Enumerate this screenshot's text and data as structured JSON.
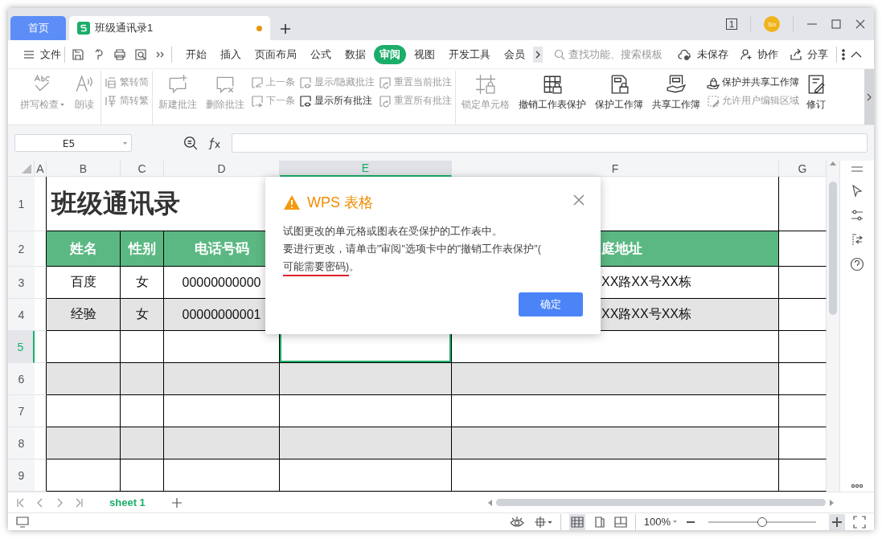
{
  "title_bar": {
    "home_tab": {
      "label": "首页",
      "selected": false
    },
    "doc_tab": {
      "label": "班级通讯录1",
      "selected": true,
      "unsaved": true
    },
    "window_count": "1",
    "avatar": "Sn"
  },
  "menu": {
    "file": "文件",
    "tabs": [
      {
        "label": "开始",
        "selected": false
      },
      {
        "label": "插入",
        "selected": false
      },
      {
        "label": "页面布局",
        "selected": false
      },
      {
        "label": "公式",
        "selected": false
      },
      {
        "label": "数据",
        "selected": false
      },
      {
        "label": "审阅",
        "selected": true
      },
      {
        "label": "视图",
        "selected": false
      },
      {
        "label": "开发工具",
        "selected": false
      },
      {
        "label": "会员",
        "selected": false
      }
    ],
    "search": {
      "placeholder": "查找功能、搜索模板"
    },
    "actions": [
      "未保存",
      "协作",
      "分享"
    ]
  },
  "ribbon": {
    "groups": [
      {
        "items": [
          {
            "kind": "large",
            "label": "拼写检查",
            "disabled": true,
            "dropdown": true
          },
          {
            "kind": "large",
            "label": "朗读",
            "disabled": true,
            "dropdown": false
          }
        ]
      },
      {
        "items": [
          {
            "kind": "stack",
            "rows": [
              {
                "label": "繁转简",
                "disabled": true
              },
              {
                "label": "简转繁",
                "disabled": true
              }
            ]
          }
        ]
      },
      {
        "items": [
          {
            "kind": "large",
            "label": "新建批注",
            "disabled": true,
            "dropdown": false
          },
          {
            "kind": "large",
            "label": "删除批注",
            "disabled": true,
            "dropdown": false
          },
          {
            "kind": "stack",
            "rows": [
              {
                "label": "上一条",
                "disabled": true
              },
              {
                "label": "下一条",
                "disabled": true
              }
            ]
          },
          {
            "kind": "stack",
            "rows": [
              {
                "label": "显示/隐藏批注",
                "disabled": true
              },
              {
                "label": "显示所有批注",
                "disabled": false
              }
            ]
          },
          {
            "kind": "stack",
            "rows": [
              {
                "label": "重置当前批注",
                "disabled": true
              },
              {
                "label": "重置所有批注",
                "disabled": true
              }
            ]
          }
        ]
      },
      {
        "items": [
          {
            "kind": "large",
            "label": "锁定单元格",
            "disabled": true,
            "dropdown": false
          },
          {
            "kind": "large",
            "label": "撤销工作表保护",
            "disabled": false,
            "dropdown": false
          },
          {
            "kind": "large",
            "label": "保护工作簿",
            "disabled": false,
            "dropdown": false
          },
          {
            "kind": "large",
            "label": "共享工作簿",
            "disabled": false,
            "dropdown": false
          },
          {
            "kind": "stack",
            "rows": [
              {
                "label": "保护并共享工作簿",
                "disabled": false
              },
              {
                "label": "允许用户编辑区域",
                "disabled": true
              }
            ]
          },
          {
            "kind": "large",
            "label": "修订",
            "disabled": false,
            "dropdown": false
          }
        ]
      }
    ]
  },
  "formula_bar": {
    "cell_ref": "E5"
  },
  "table": {
    "columns": [
      {
        "label": "A",
        "selected": false
      },
      {
        "label": "B",
        "selected": false
      },
      {
        "label": "C",
        "selected": false
      },
      {
        "label": "D",
        "selected": false
      },
      {
        "label": "E",
        "selected": true
      },
      {
        "label": "F",
        "selected": false
      },
      {
        "label": "G",
        "selected": false
      }
    ],
    "rows": [
      {
        "header": "1",
        "kind": "title",
        "selected": false,
        "cells": [
          null,
          "班级通讯录"
        ]
      },
      {
        "header": "2",
        "kind": "heading",
        "selected": false,
        "cells": [
          null,
          "姓名",
          "性别",
          "电话号码",
          null,
          "庭地址",
          null
        ]
      },
      {
        "header": "3",
        "kind": "data",
        "selected": false,
        "shaded": false,
        "cells": [
          null,
          "百度",
          "女",
          "00000000000",
          null,
          "XX路XX号XX栋",
          null
        ]
      },
      {
        "header": "4",
        "kind": "data",
        "selected": false,
        "shaded": true,
        "cells": [
          null,
          "经验",
          "女",
          "00000000001",
          null,
          "XX路XX号XX栋",
          null
        ]
      },
      {
        "header": "5",
        "kind": "data",
        "selected": true,
        "shaded": false,
        "cells": [
          null,
          null,
          null,
          null,
          null,
          null,
          null
        ]
      },
      {
        "header": "6",
        "kind": "data",
        "selected": false,
        "shaded": true,
        "cells": [
          null,
          null,
          null,
          null,
          null,
          null,
          null
        ]
      },
      {
        "header": "7",
        "kind": "data",
        "selected": false,
        "shaded": false,
        "cells": [
          null,
          null,
          null,
          null,
          null,
          null,
          null
        ]
      },
      {
        "header": "8",
        "kind": "data",
        "selected": false,
        "shaded": true,
        "cells": [
          null,
          null,
          null,
          null,
          null,
          null,
          null
        ]
      },
      {
        "header": "9",
        "kind": "data",
        "selected": false,
        "shaded": false,
        "cells": [
          null,
          null,
          null,
          null,
          null,
          null,
          null
        ]
      }
    ]
  },
  "dialog": {
    "title": "WPS 表格",
    "message_lines": [
      [
        {
          "text": "试图更改的单元格或图表在受保护的工作表中。",
          "underlined": false
        }
      ],
      [
        {
          "text": "要进行更改，请单击\"审阅\"选项卡中的\"撤销工作表保护\"(",
          "underlined": false
        }
      ],
      [
        {
          "text": "可能需要密码)",
          "underlined": true
        },
        {
          "text": "。",
          "underlined": false
        }
      ]
    ],
    "button": "确定"
  },
  "sheet_tabs": [
    {
      "label": "sheet 1",
      "selected": true
    }
  ],
  "status_bar": {
    "zoom": "100%",
    "zoom_slider": {
      "level": 0.5
    }
  }
}
